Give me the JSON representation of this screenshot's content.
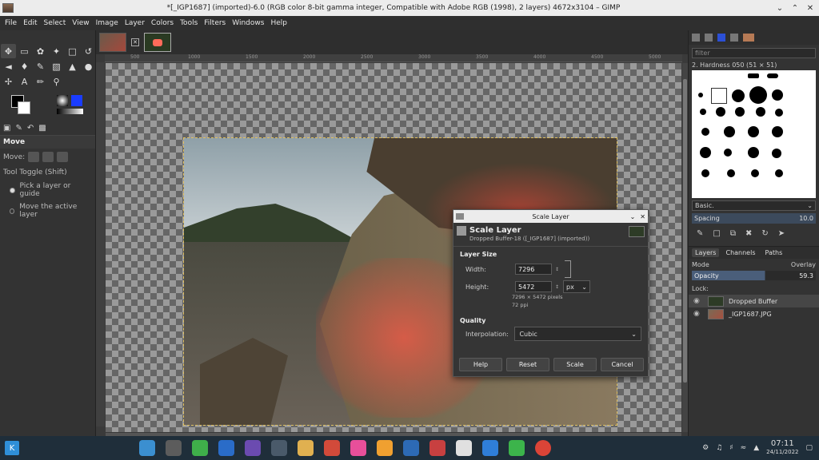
{
  "window": {
    "title": "*[_IGP1687] (imported)-6.0 (RGB color 8-bit gamma integer, Compatible with Adobe RGB (1998), 2 layers) 4672x3104 – GIMP"
  },
  "menu": [
    "File",
    "Edit",
    "Select",
    "View",
    "Image",
    "Layer",
    "Colors",
    "Tools",
    "Filters",
    "Windows",
    "Help"
  ],
  "tool_options": {
    "title": "Move",
    "move_label": "Move:",
    "toggle_label": "Tool Toggle  (Shift)",
    "option1": "Pick a layer or guide",
    "option2": "Move the active layer"
  },
  "ruler_ticks": [
    "500",
    "1000",
    "1500",
    "2000",
    "2500",
    "3000",
    "3500",
    "4000",
    "4500",
    "5000"
  ],
  "brushes": {
    "filter_placeholder": "filter",
    "brush_name": "2. Hardness 050 (51 × 51)",
    "preset": "Basic.",
    "spacing_label": "Spacing",
    "spacing_value": "10.0"
  },
  "layers_panel": {
    "tabs": [
      "Layers",
      "Channels",
      "Paths"
    ],
    "mode_label": "Mode",
    "mode_value": "Overlay",
    "opacity_label": "Opacity",
    "opacity_value": "59.3",
    "lock_label": "Lock:",
    "layers": [
      {
        "name": "Dropped Buffer"
      },
      {
        "name": "_IGP1687.JPG"
      }
    ]
  },
  "dialog": {
    "window_title": "Scale Layer",
    "heading": "Scale Layer",
    "subheading": "Dropped Buffer-18 ([_IGP1687] (imported))",
    "layer_size_label": "Layer Size",
    "width_label": "Width:",
    "width_value": "7296",
    "height_label": "Height:",
    "height_value": "5472",
    "unit": "px",
    "pixels_info": "7296 × 5472 pixels",
    "ppi_info": "72 ppi",
    "quality_label": "Quality",
    "interp_label": "Interpolation:",
    "interp_value": "Cubic",
    "buttons": {
      "help": "Help",
      "reset": "Reset",
      "scale": "Scale",
      "cancel": "Cancel"
    }
  },
  "taskbar": {
    "time": "07:11",
    "date": "24/11/2022"
  },
  "colors": {
    "accent": "#2b4fd6",
    "taskbar": "#1f2e3a"
  }
}
